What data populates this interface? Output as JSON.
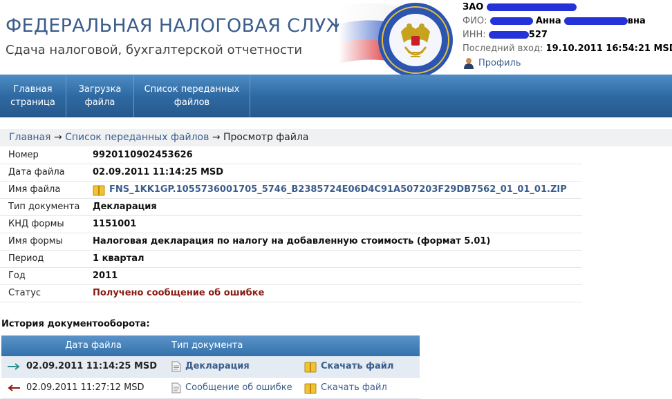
{
  "header": {
    "title": "ФЕДЕРАЛЬНАЯ НАЛОГОВАЯ СЛУЖБА",
    "subtitle": "Сдача налоговой, бухгалтерской отчетности"
  },
  "user": {
    "org_prefix": "ЗАО",
    "fio_label": "ФИО:",
    "fio_value": "Анна",
    "fio_suffix": "вна",
    "inn_label": "ИНН:",
    "inn_suffix": "527",
    "last_login_label": "Последний вход:",
    "last_login_value": "19.10.2011 16:54:21 MSD",
    "profile_label": "Профиль"
  },
  "nav": {
    "items": [
      {
        "label": "Главная страница"
      },
      {
        "label": "Загрузка файла"
      },
      {
        "label": "Список переданных файлов"
      }
    ]
  },
  "breadcrumb": {
    "home": "Главная",
    "list": "Список переданных файлов",
    "current": "Просмотр файла",
    "separator": "→"
  },
  "details": {
    "rows": [
      {
        "label": "Номер",
        "value": "9920110902453626"
      },
      {
        "label": "Дата файла",
        "value": "02.09.2011 11:14:25 MSD"
      },
      {
        "label": "Имя файла",
        "value": "FNS_1KK1GP.1055736001705_5746_B2385724E06D4C91A507203F29DB7562_01_01_01.ZIP"
      },
      {
        "label": "Тип документа",
        "value": "Декларация"
      },
      {
        "label": "КНД формы",
        "value": "1151001"
      },
      {
        "label": "Имя формы",
        "value": "Налоговая декларация по налогу на добавленную стоимость (формат 5.01)"
      },
      {
        "label": "Период",
        "value": "1 квартал"
      },
      {
        "label": "Год",
        "value": "2011"
      },
      {
        "label": "Статус",
        "value": "Получено сообщение об ошибке"
      }
    ]
  },
  "history": {
    "title": "История документооборота:",
    "columns": {
      "date": "Дата файла",
      "type": "Тип документа"
    },
    "rows": [
      {
        "date": "02.09.2011 11:14:25 MSD",
        "type": "Декларация",
        "download": "Скачать файл",
        "direction": "outgoing",
        "arrow_color": "#2a8f8a"
      },
      {
        "date": "02.09.2011 11:27:12 MSD",
        "type": "Сообщение об ошибке",
        "download": "Скачать файл",
        "direction": "incoming",
        "arrow_color": "#8a1a10"
      }
    ]
  },
  "colors": {
    "accent": "#3a5d8c",
    "nav": "#2f6aa3",
    "error": "#8a1a10"
  }
}
